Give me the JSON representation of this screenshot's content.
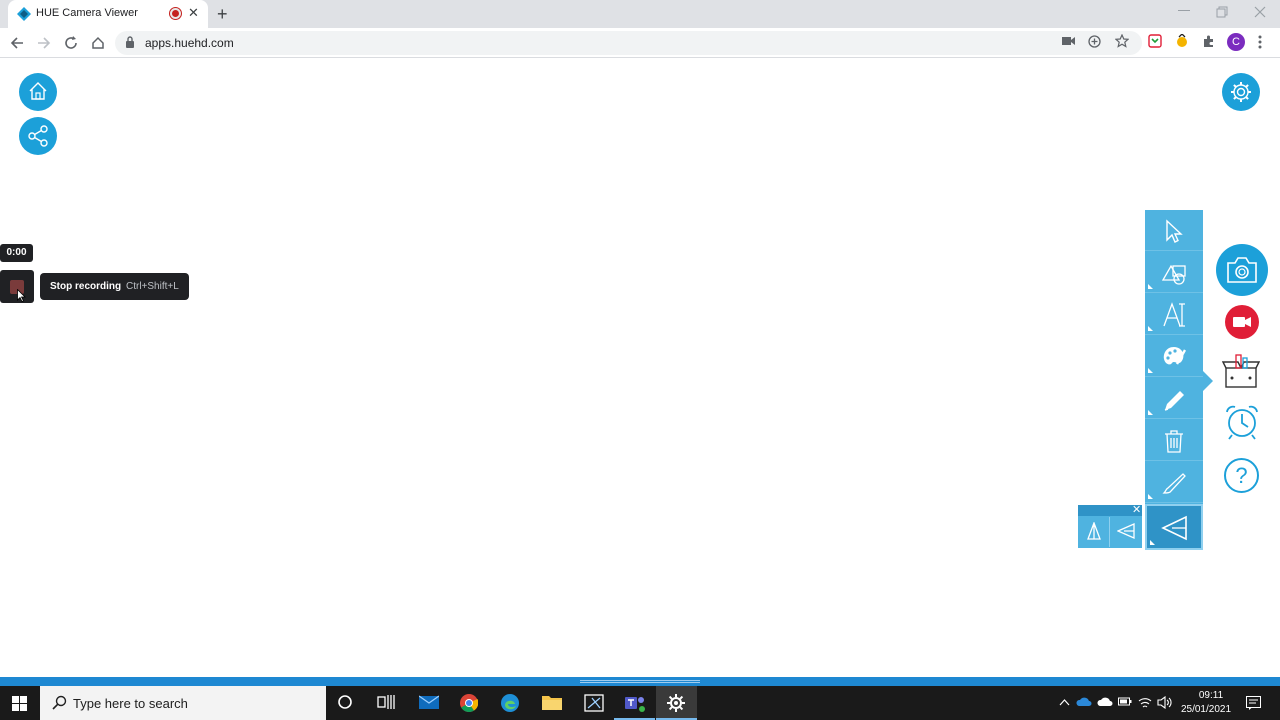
{
  "browser": {
    "tab_title": "HUE Camera Viewer",
    "tab_close": "✕",
    "new_tab": "+",
    "url": "apps.huehd.com",
    "profile_initial": "C"
  },
  "app": {
    "recording": {
      "timer": "0:00",
      "tooltip_label": "Stop recording",
      "tooltip_shortcut": "Ctrl+Shift+L"
    },
    "tools": [
      "pointer",
      "shapes",
      "text",
      "color",
      "pen",
      "delete",
      "brush",
      "ruler"
    ],
    "help_label": "?",
    "mini_close": "✕",
    "colors": {
      "accent": "#1ca0d9",
      "panel": "#4fb3e0",
      "record": "#e01e37"
    }
  },
  "taskbar": {
    "search_placeholder": "Type here to search",
    "time": "09:11",
    "date": "25/01/2021"
  }
}
